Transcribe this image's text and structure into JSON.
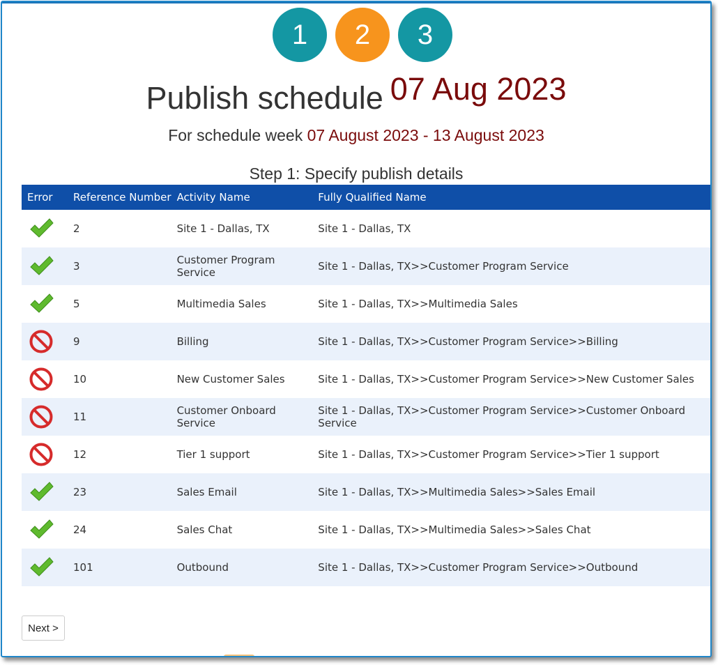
{
  "steps": [
    {
      "number": "1",
      "color": "#1497a3"
    },
    {
      "number": "2",
      "color": "#f7941d"
    },
    {
      "number": "3",
      "color": "#1497a3"
    }
  ],
  "header": {
    "title": "Publish schedule",
    "date": "07 Aug 2023",
    "week_prefix": "For schedule week",
    "week_range": "07 August 2023 - 13 August 2023",
    "step_text": "Step 1: Specify publish details"
  },
  "table": {
    "columns": [
      "Error",
      "Reference Number",
      "Activity Name",
      "Fully Qualified Name"
    ],
    "rows": [
      {
        "status": "ok",
        "ref": "2",
        "activity": "Site 1 - Dallas, TX",
        "fqn": "Site 1 - Dallas, TX"
      },
      {
        "status": "ok",
        "ref": "3",
        "activity": "Customer Program Service",
        "fqn": "Site 1 - Dallas, TX>>Customer Program Service"
      },
      {
        "status": "ok",
        "ref": "5",
        "activity": "Multimedia Sales",
        "fqn": "Site 1 - Dallas, TX>>Multimedia Sales"
      },
      {
        "status": "error",
        "ref": "9",
        "activity": "Billing",
        "fqn": "Site 1 - Dallas, TX>>Customer Program Service>>Billing"
      },
      {
        "status": "error",
        "ref": "10",
        "activity": "New Customer Sales",
        "fqn": "Site 1 - Dallas, TX>>Customer Program Service>>New Customer Sales"
      },
      {
        "status": "error",
        "ref": "11",
        "activity": "Customer Onboard Service",
        "fqn": "Site 1 - Dallas, TX>>Customer Program Service>>Customer Onboard Service"
      },
      {
        "status": "error",
        "ref": "12",
        "activity": "Tier 1 support",
        "fqn": "Site 1 - Dallas, TX>>Customer Program Service>>Tier 1 support"
      },
      {
        "status": "ok",
        "ref": "23",
        "activity": "Sales Email",
        "fqn": "Site 1 - Dallas, TX>>Multimedia Sales>>Sales Email"
      },
      {
        "status": "ok",
        "ref": "24",
        "activity": "Sales Chat",
        "fqn": "Site 1 - Dallas, TX>>Multimedia Sales>>Sales Chat"
      },
      {
        "status": "ok",
        "ref": "101",
        "activity": "Outbound",
        "fqn": "Site 1 - Dallas, TX>>Customer Program Service>>Outbound"
      }
    ]
  },
  "icons": {
    "ok": "check-icon",
    "error": "no-entry-icon"
  },
  "colors": {
    "header_bg": "#0f4fa8",
    "accent_red": "#7a0b0b",
    "check_green": "#5fba2e",
    "error_red": "#d62b2b"
  },
  "next_button": "Next >"
}
